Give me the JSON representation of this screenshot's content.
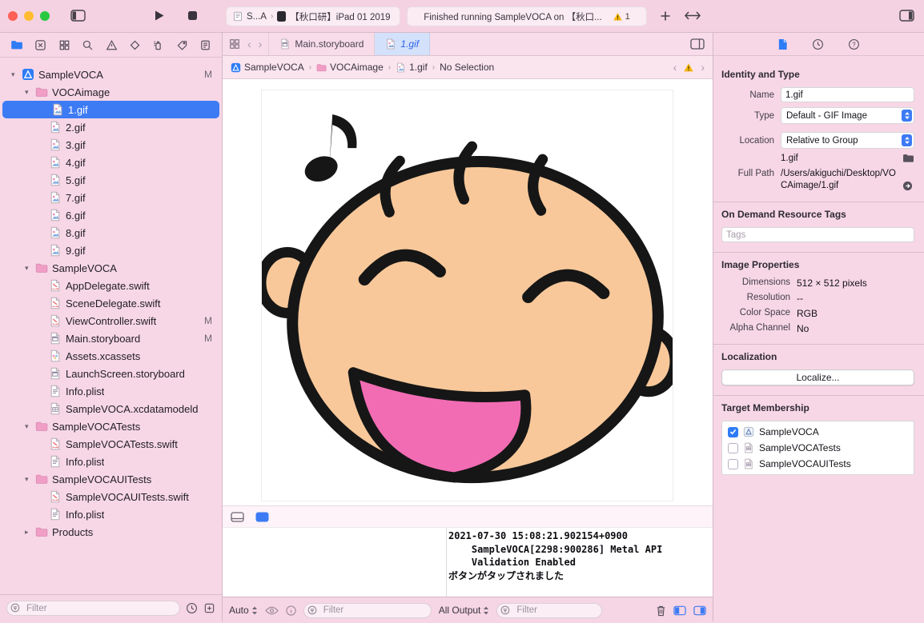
{
  "titlebar": {
    "scheme_app": "S...A",
    "scheme_device": "【秋口研】iPad 01 2019",
    "status_text": "Finished running SampleVOCA on 【秋口...",
    "status_warning_count": "1"
  },
  "navigator": {
    "filter_placeholder": "Filter",
    "tree": [
      {
        "label": "SampleVOCA",
        "icon": "project",
        "level": 0,
        "chevron": "down",
        "badge": "M"
      },
      {
        "label": "VOCAimage",
        "icon": "folder",
        "level": 1,
        "chevron": "down"
      },
      {
        "label": "1.gif",
        "icon": "image",
        "level": 2,
        "selected": true
      },
      {
        "label": "2.gif",
        "icon": "image",
        "level": 2
      },
      {
        "label": "3.gif",
        "icon": "image",
        "level": 2
      },
      {
        "label": "4.gif",
        "icon": "image",
        "level": 2
      },
      {
        "label": "5.gif",
        "icon": "image",
        "level": 2
      },
      {
        "label": "7.gif",
        "icon": "image",
        "level": 2
      },
      {
        "label": "6.gif",
        "icon": "image",
        "level": 2
      },
      {
        "label": "8.gif",
        "icon": "image",
        "level": 2
      },
      {
        "label": "9.gif",
        "icon": "image",
        "level": 2
      },
      {
        "label": "SampleVOCA",
        "icon": "folder",
        "level": 1,
        "chevron": "down"
      },
      {
        "label": "AppDelegate.swift",
        "icon": "swift",
        "level": 2
      },
      {
        "label": "SceneDelegate.swift",
        "icon": "swift",
        "level": 2
      },
      {
        "label": "ViewController.swift",
        "icon": "swift",
        "level": 2,
        "badge": "M"
      },
      {
        "label": "Main.storyboard",
        "icon": "storyboard",
        "level": 2,
        "badge": "M"
      },
      {
        "label": "Assets.xcassets",
        "icon": "assets",
        "level": 2
      },
      {
        "label": "LaunchScreen.storyboard",
        "icon": "storyboard",
        "level": 2
      },
      {
        "label": "Info.plist",
        "icon": "plist",
        "level": 2
      },
      {
        "label": "SampleVOCA.xcdatamodeld",
        "icon": "datamodel",
        "level": 2
      },
      {
        "label": "SampleVOCATests",
        "icon": "folder",
        "level": 1,
        "chevron": "down"
      },
      {
        "label": "SampleVOCATests.swift",
        "icon": "swift",
        "level": 2
      },
      {
        "label": "Info.plist",
        "icon": "plist",
        "level": 2
      },
      {
        "label": "SampleVOCAUITests",
        "icon": "folder",
        "level": 1,
        "chevron": "down"
      },
      {
        "label": "SampleVOCAUITests.swift",
        "icon": "swift",
        "level": 2
      },
      {
        "label": "Info.plist",
        "icon": "plist",
        "level": 2
      },
      {
        "label": "Products",
        "icon": "folder",
        "level": 1,
        "chevron": "right"
      }
    ]
  },
  "editor": {
    "tabs": [
      {
        "label": "Main.storyboard",
        "icon": "storyboard",
        "active": false
      },
      {
        "label": "1.gif",
        "icon": "image",
        "active": true
      }
    ],
    "breadcrumbs": [
      {
        "label": "SampleVOCA",
        "icon": "project"
      },
      {
        "label": "VOCAimage",
        "icon": "folder"
      },
      {
        "label": "1.gif",
        "icon": "image"
      },
      {
        "label": "No Selection",
        "icon": null
      }
    ]
  },
  "debug": {
    "console_lines": [
      "2021-07-30 15:08:21.902154+0900",
      "    SampleVOCA[2298:900286] Metal API",
      "    Validation Enabled",
      "ボタンがタップされました"
    ],
    "auto_label": "Auto",
    "all_output_label": "All Output",
    "filter_placeholder": "Filter"
  },
  "inspector": {
    "identity_heading": "Identity and Type",
    "name_label": "Name",
    "name_value": "1.gif",
    "type_label": "Type",
    "type_value": "Default - GIF Image",
    "location_label": "Location",
    "location_value": "Relative to Group",
    "file_ref": "1.gif",
    "full_path_label": "Full Path",
    "full_path_value": "/Users/akiguchi/Desktop/VOCAimage/1.gif",
    "tags_heading": "On Demand Resource Tags",
    "tags_placeholder": "Tags",
    "image_props_heading": "Image Properties",
    "props": [
      {
        "label": "Dimensions",
        "value": "512 × 512 pixels"
      },
      {
        "label": "Resolution",
        "value": "--"
      },
      {
        "label": "Color Space",
        "value": "RGB"
      },
      {
        "label": "Alpha Channel",
        "value": "No"
      }
    ],
    "localization_heading": "Localization",
    "localize_button": "Localize...",
    "target_heading": "Target Membership",
    "targets": [
      {
        "label": "SampleVOCA",
        "checked": true,
        "icon": "target"
      },
      {
        "label": "SampleVOCATests",
        "checked": false,
        "icon": "tests"
      },
      {
        "label": "SampleVOCAUITests",
        "checked": false,
        "icon": "tests"
      }
    ]
  },
  "colors": {
    "accent_blue": "#3d7bf5",
    "chrome_pink": "#f6d5e4",
    "warning_yellow": "#f5b50a",
    "face_skin": "#f8c89a",
    "mouth_pink": "#f26cb4"
  }
}
